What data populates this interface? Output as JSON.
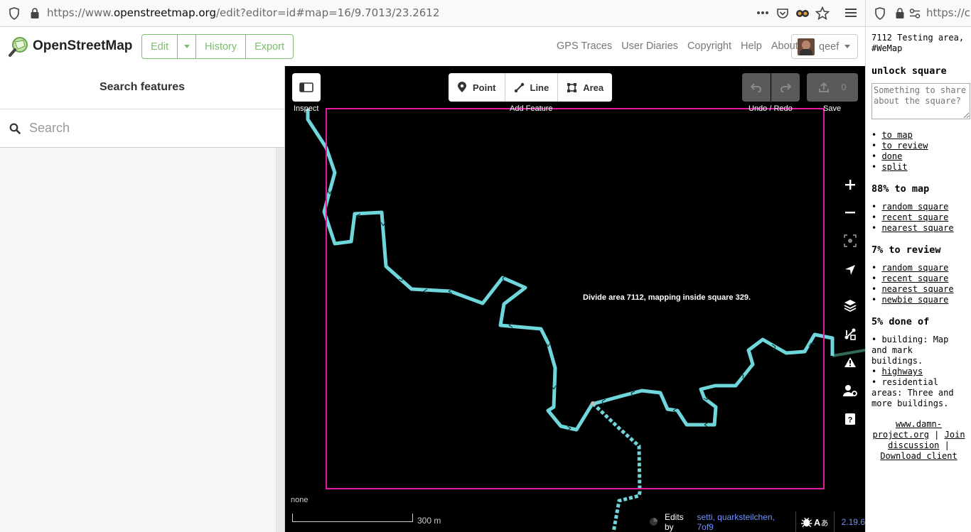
{
  "browser": {
    "url_prefix": "https://www.",
    "url_domain": "openstreetmap.org",
    "url_rest": "/edit?editor=id#map=16/9.7013/23.2612",
    "url2": "https://cli"
  },
  "header": {
    "brand": "OpenStreetMap",
    "edit_label": "Edit",
    "history_label": "History",
    "export_label": "Export",
    "nav": [
      "GPS Traces",
      "User Diaries",
      "Copyright",
      "Help",
      "About"
    ],
    "user": "qeef"
  },
  "sidebar": {
    "title": "Search features",
    "search_placeholder": "Search"
  },
  "map": {
    "inspect_label": "Inspect",
    "add_feature_label": "Add Feature",
    "point_label": "Point",
    "line_label": "Line",
    "area_label": "Area",
    "undo_redo_label": "Undo / Redo",
    "save_label": "Save",
    "save_count": "0",
    "message": "Divide area 7112, mapping inside square 329.",
    "imagery_none": "none",
    "scale_label": "300 m",
    "edits_by": "Edits by",
    "contributors": "setti, quarksteilchen, 7of9",
    "version": "2.19.6",
    "colors": {
      "square": "#e51aa0",
      "river": "#6fd6dc",
      "background": "#000000"
    }
  },
  "right_panel": {
    "area_title": "7112 Testing area, #WeMap",
    "heading": "unlock square",
    "comment_placeholder": "Something to share about the square?",
    "actions": [
      "to map",
      "to review",
      "done",
      "split"
    ],
    "to_map_heading": "88% to map",
    "to_map_links": [
      "random square",
      "recent square",
      "nearest square"
    ],
    "to_review_heading": "7% to review",
    "to_review_links": [
      "random square",
      "recent square",
      "nearest square",
      "newbie square"
    ],
    "done_heading": "5% done of",
    "done_items": [
      {
        "text": "building: Map and mark buildings.",
        "link": false
      },
      {
        "text": "highways",
        "link": true
      },
      {
        "text": "residential areas: Three and more buildings.",
        "link": false
      }
    ],
    "footer_site": "www.damn-project.org",
    "footer_discussion": "Join discussion",
    "footer_download": "Download client",
    "footer_sep": "|"
  }
}
